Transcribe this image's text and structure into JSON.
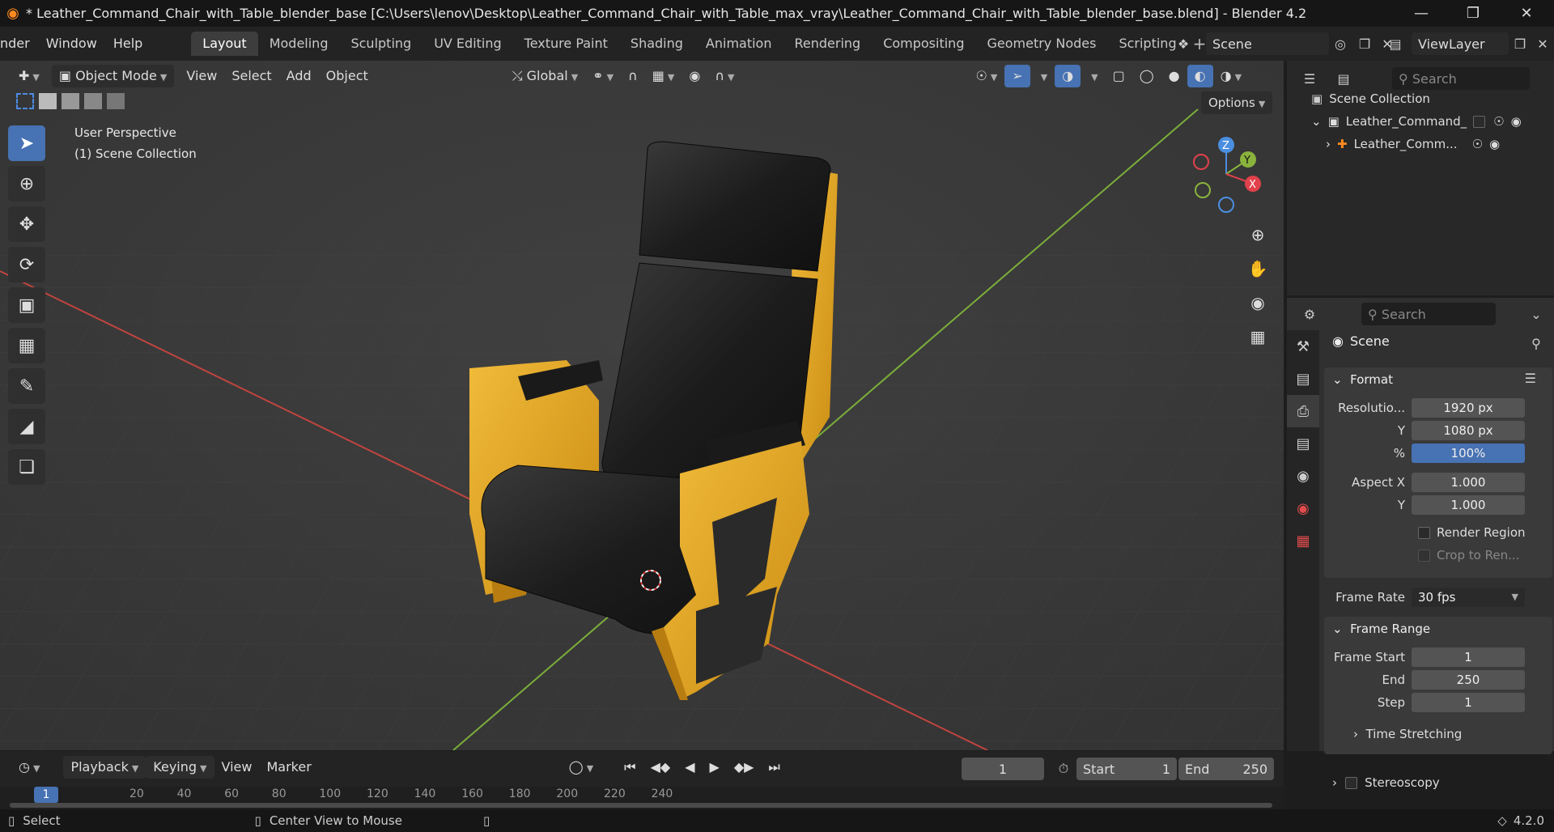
{
  "titlebar": {
    "title": "* Leather_Command_Chair_with_Table_blender_base [C:\\Users\\lenov\\Desktop\\Leather_Command_Chair_with_Table_max_vray\\Leather_Command_Chair_with_Table_blender_base.blend] - Blender 4.2"
  },
  "menubar": {
    "menus": [
      "nder",
      "Window",
      "Help"
    ],
    "workspaces": [
      "Layout",
      "Modeling",
      "Sculpting",
      "UV Editing",
      "Texture Paint",
      "Shading",
      "Animation",
      "Rendering",
      "Compositing",
      "Geometry Nodes",
      "Scripting"
    ],
    "scene": "Scene",
    "view_layer": "ViewLayer"
  },
  "viewport": {
    "mode": "Object Mode",
    "menus": [
      "View",
      "Select",
      "Add",
      "Object"
    ],
    "orientation": "Global",
    "options": "Options",
    "perspective": "User Perspective",
    "collection": "(1) Scene Collection",
    "gizmo": {
      "z": "Z",
      "y": "Y",
      "x": "X"
    }
  },
  "outliner": {
    "search_placeholder": "Search",
    "root": "Scene Collection",
    "items": [
      {
        "label": "Leather_Command_"
      },
      {
        "label": "Leather_Comm..."
      }
    ]
  },
  "properties": {
    "search_placeholder": "Search",
    "context": "Scene",
    "format": {
      "title": "Format",
      "res_label": "Resolutio...",
      "res_x": "1920 px",
      "y_label": "Y",
      "res_y": "1080 px",
      "pct_label": "%",
      "pct": "100%",
      "aspect_label": "Aspect X",
      "aspect_x": "1.000",
      "aspect_y_label": "Y",
      "aspect_y": "1.000",
      "render_region": "Render Region",
      "crop": "Crop to Ren...",
      "frame_rate_label": "Frame Rate",
      "frame_rate": "30 fps"
    },
    "frame_range": {
      "title": "Frame Range",
      "start_label": "Frame Start",
      "start": "1",
      "end_label": "End",
      "end": "250",
      "step_label": "Step",
      "step": "1"
    },
    "time_stretching": "Time Stretching",
    "stereoscopy": "Stereoscopy"
  },
  "timeline": {
    "menus": [
      "Playback",
      "Keying",
      "View",
      "Marker"
    ],
    "current_frame": "1",
    "start_label": "Start",
    "start": "1",
    "end_label": "End",
    "end": "250",
    "ticks": [
      "1",
      "20",
      "40",
      "60",
      "80",
      "100",
      "120",
      "140",
      "160",
      "180",
      "200",
      "220",
      "240"
    ]
  },
  "statusbar": {
    "select": "Select",
    "center": "Center View to Mouse",
    "version": "4.2.0"
  },
  "colors": {
    "accent": "#4772b3",
    "chair_leather": "#1e1e1e",
    "chair_frame": "#e0a526",
    "grid_x": "#c0443f",
    "grid_y": "#7cae3a"
  }
}
